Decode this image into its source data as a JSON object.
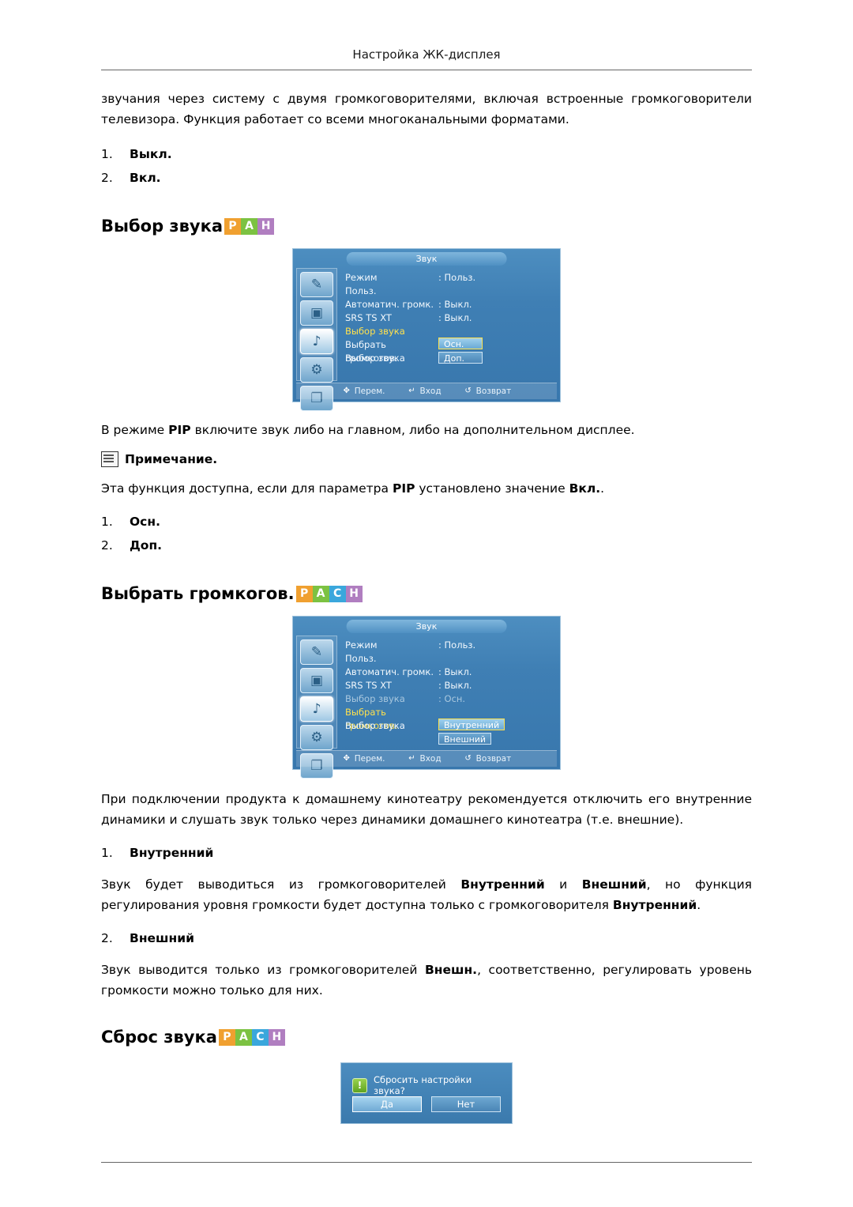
{
  "header": {
    "title": "Настройка ЖК-дисплея"
  },
  "intro": {
    "paragraph": "звучания через систему с двумя громкоговорителями, включая встроенные громкоговорители телевизора. Функция работает со всеми многоканальными форматами.",
    "items": [
      {
        "num": "1.",
        "label": "Выкл."
      },
      {
        "num": "2.",
        "label": "Вкл."
      }
    ]
  },
  "sections": [
    {
      "title": "Выбор звука",
      "badges": [
        "P",
        "A",
        "H"
      ],
      "osd": {
        "title": "Звук",
        "rows": [
          {
            "label": "Режим",
            "value": ": Польз.",
            "dim": false,
            "highlight": false
          },
          {
            "label": "Польз.",
            "value": "",
            "dim": false,
            "highlight": false
          },
          {
            "label": "Автоматич. громк.",
            "value": ": Выкл.",
            "dim": false,
            "highlight": false
          },
          {
            "label": "SRS TS XT",
            "value": ": Выкл.",
            "dim": false,
            "highlight": false
          },
          {
            "label": "Выбор звука",
            "value": "",
            "dim": false,
            "highlight": true
          },
          {
            "label": "Выбрать громкогов.",
            "value": "",
            "dim": false,
            "highlight": false
          },
          {
            "label": "Выбор звука",
            "value": "",
            "dim": false,
            "highlight": false
          }
        ],
        "options": [
          {
            "label": "Осн.",
            "active": true
          },
          {
            "label": "Доп.",
            "active": false
          }
        ],
        "footer": [
          {
            "icon": "✥",
            "label": "Перем."
          },
          {
            "icon": "↵",
            "label": "Вход"
          },
          {
            "icon": "↺",
            "label": "Возврат"
          }
        ]
      },
      "after_text": [
        {
          "type": "mixed",
          "parts": [
            {
              "text": "В режиме ",
              "bold": false
            },
            {
              "text": "PIP",
              "bold": true
            },
            {
              "text": " включите звук либо на главном, либо на дополнительном дисплее.",
              "bold": false
            }
          ]
        }
      ],
      "note_label": "Примечание.",
      "note_text_parts": [
        {
          "text": "Эта функция доступна, если для параметра ",
          "bold": false
        },
        {
          "text": "PIP",
          "bold": true
        },
        {
          "text": " установлено значение ",
          "bold": false
        },
        {
          "text": "Вкл.",
          "bold": true
        },
        {
          "text": ".",
          "bold": false
        }
      ],
      "items": [
        {
          "num": "1.",
          "label": "Осн."
        },
        {
          "num": "2.",
          "label": "Доп."
        }
      ]
    },
    {
      "title": "Выбрать громкогов.",
      "badges": [
        "P",
        "A",
        "C",
        "H"
      ],
      "osd": {
        "title": "Звук",
        "rows": [
          {
            "label": "Режим",
            "value": ": Польз.",
            "dim": false,
            "highlight": false
          },
          {
            "label": "Польз.",
            "value": "",
            "dim": false,
            "highlight": false
          },
          {
            "label": "Автоматич. громк.",
            "value": ": Выкл.",
            "dim": false,
            "highlight": false
          },
          {
            "label": "SRS TS XT",
            "value": ": Выкл.",
            "dim": false,
            "highlight": false
          },
          {
            "label": "Выбор звука",
            "value": ": Осн.",
            "dim": true,
            "highlight": false
          },
          {
            "label": "Выбрать громкогов.",
            "value": "",
            "dim": false,
            "highlight": true
          },
          {
            "label": "Выбор звука",
            "value": "",
            "dim": false,
            "highlight": false
          }
        ],
        "options": [
          {
            "label": "Внутренний",
            "active": true
          },
          {
            "label": "Внешний",
            "active": false
          }
        ],
        "footer": [
          {
            "icon": "✥",
            "label": "Перем."
          },
          {
            "icon": "↵",
            "label": "Вход"
          },
          {
            "icon": "↺",
            "label": "Возврат"
          }
        ]
      },
      "after_paragraph": "При подключении продукта к домашнему кинотеатру рекомендуется отключить его внутренние динамики и слушать звук только через динамики домашнего кинотеатра (т.е. внешние).",
      "items": [
        {
          "num": "1.",
          "label": "Внутренний"
        },
        {
          "num": "2.",
          "label": "Внешний"
        }
      ],
      "desc1_parts": [
        {
          "text": "Звук будет выводиться из громкоговорителей ",
          "bold": false
        },
        {
          "text": "Внутренний",
          "bold": true
        },
        {
          "text": " и ",
          "bold": false
        },
        {
          "text": "Внешний",
          "bold": true
        },
        {
          "text": ", но функция регулирования уровня громкости будет доступна только с громкоговорителя ",
          "bold": false
        },
        {
          "text": "Внутренний",
          "bold": true
        },
        {
          "text": ".",
          "bold": false
        }
      ],
      "desc2_parts": [
        {
          "text": "Звук выводится только из громкоговорителей ",
          "bold": false
        },
        {
          "text": "Внешн.",
          "bold": true
        },
        {
          "text": ", соответственно, регулировать уровень громкости можно только для них.",
          "bold": false
        }
      ]
    },
    {
      "title": "Сброс звука",
      "badges": [
        "P",
        "A",
        "C",
        "H"
      ],
      "dialog": {
        "question": "Сбросить настройки звука?",
        "icon": "!",
        "buttons": [
          {
            "label": "Да",
            "selected": true
          },
          {
            "label": "Нет",
            "selected": false
          }
        ]
      }
    }
  ]
}
